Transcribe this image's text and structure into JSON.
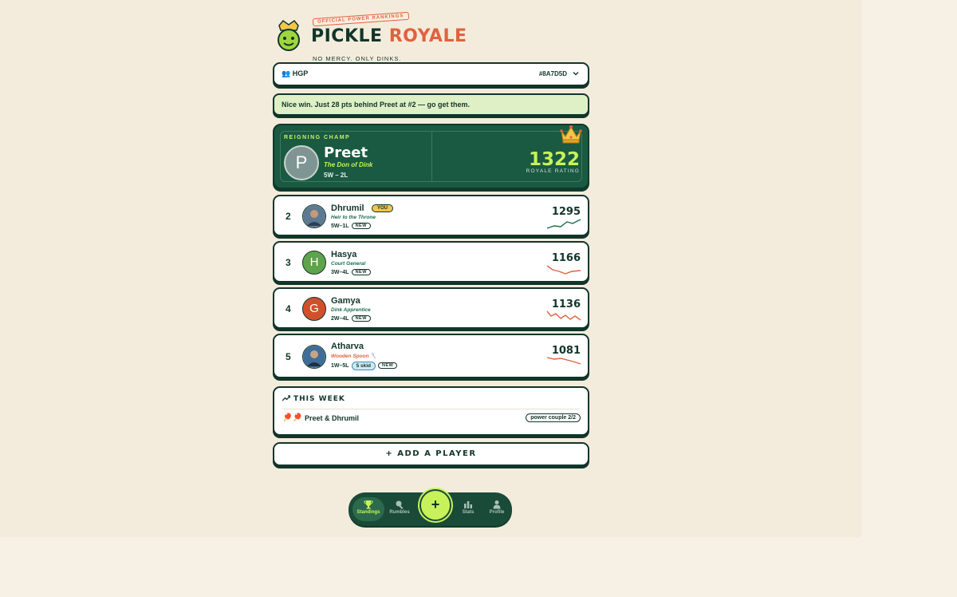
{
  "brand": {
    "tag": "OFFICIAL POWER RANKINGS",
    "title_part1": "PICKLE",
    "title_part2": "ROYALE",
    "subtitle": "NO MERCY. ONLY DINKS."
  },
  "group": {
    "icon": "people-icon",
    "name": "👥 HGP",
    "code": "#8A7D5D"
  },
  "banner": {
    "text": "Nice win. Just 28 pts behind Preet at #2 — go get them."
  },
  "champ": {
    "label": "REIGNING CHAMP",
    "initial": "P",
    "name": "Preet",
    "title": "The Don of Dink",
    "record": "5W – 2L",
    "rating": "1322",
    "rating_label": "ROYALE RATING"
  },
  "players": [
    {
      "rank": "2",
      "name": "Dhrumil",
      "you_badge": "YOU",
      "title": "Heir to the Throne",
      "record": "5W–1L",
      "new_badge": "NEW",
      "rating": "1295",
      "trend": "up"
    },
    {
      "rank": "3",
      "initial": "H",
      "name": "Hasya",
      "title": "Court General",
      "record": "3W–4L",
      "new_badge": "NEW",
      "rating": "1166",
      "trend": "down"
    },
    {
      "rank": "4",
      "initial": "G",
      "name": "Gamya",
      "title": "Dink Apprentice",
      "record": "2W–4L",
      "new_badge": "NEW",
      "rating": "1136",
      "trend": "down"
    },
    {
      "rank": "5",
      "name": "Atharva",
      "title": "Wooden Spoon 🥄",
      "record": "1W–5L",
      "skid": "5 skid",
      "new_badge": "NEW",
      "rating": "1081",
      "trend": "down"
    }
  ],
  "week": {
    "heading": "THIS WEEK",
    "icons": "🏓🏓",
    "names": "Preet & Dhrumil",
    "tag": "power couple 2/2"
  },
  "add_player": "+ ADD A PLAYER",
  "nav": {
    "standings": "Standings",
    "rumbles": "Rumbles",
    "fab": "+",
    "stats": "Stats",
    "profile": "Profile"
  },
  "colors": {
    "dark_green": "#12352a",
    "lime": "#c8f25a",
    "coral": "#e0623f",
    "up": "#1a6e4c",
    "down": "#e0623f"
  }
}
